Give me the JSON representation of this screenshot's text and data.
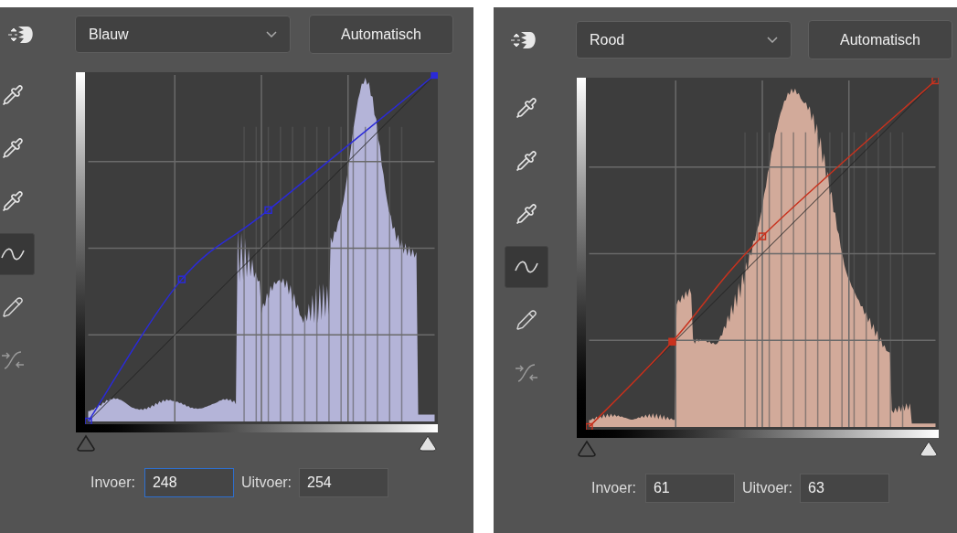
{
  "panels": [
    {
      "channel": "Blauw",
      "auto_button": "Automatisch",
      "tools": [
        {
          "kind": "eyedropper-shadow",
          "selected": false
        },
        {
          "kind": "eyedropper-midtone",
          "selected": false
        },
        {
          "kind": "eyedropper-highlight",
          "selected": false
        },
        {
          "kind": "curve",
          "selected": true
        },
        {
          "kind": "pencil",
          "selected": false
        },
        {
          "kind": "smooth",
          "selected": false
        }
      ],
      "input_label": "Invoer:",
      "input_value": "248",
      "input_focused": true,
      "output_label": "Uitvoer:",
      "output_value": "254"
    },
    {
      "channel": "Rood",
      "auto_button": "Automatisch",
      "tools": [
        {
          "kind": "eyedropper-shadow",
          "selected": false
        },
        {
          "kind": "eyedropper-midtone",
          "selected": false
        },
        {
          "kind": "eyedropper-highlight",
          "selected": false
        },
        {
          "kind": "curve",
          "selected": true
        },
        {
          "kind": "pencil",
          "selected": false
        },
        {
          "kind": "smooth",
          "selected": false
        }
      ],
      "input_label": "Invoer:",
      "input_value": "61",
      "input_focused": false,
      "output_label": "Uitvoer:",
      "output_value": "63"
    }
  ]
}
